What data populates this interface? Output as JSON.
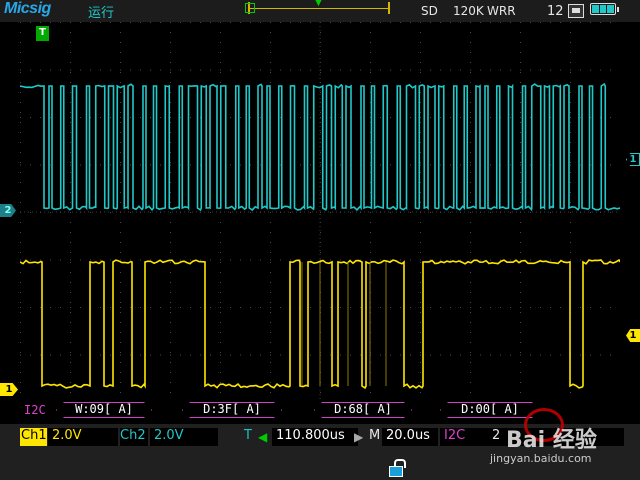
{
  "header": {
    "brand": "Micsig",
    "status": "运行",
    "acq_mode": "SD",
    "memory_depth": "120K",
    "mode": "WRR",
    "clock": "12"
  },
  "icons": {
    "usb": "usb-icon",
    "battery": "battery-icon",
    "lock": "lock-icon",
    "trigger_time": "trigger-time-marker-icon"
  },
  "markers": {
    "trigger_time": "T",
    "ch2": "2",
    "ch1": "1",
    "ch1_level": "1",
    "ch2_level": "1"
  },
  "decode": {
    "label": "I2C",
    "packets": [
      {
        "text": "W:09[ A]"
      },
      {
        "text": "D:3F[ A]"
      },
      {
        "text": "D:68[ A]"
      },
      {
        "text": "D:00[ A]"
      }
    ]
  },
  "bottom": {
    "ch1_label": "Ch1",
    "ch1_scale": "2.0V",
    "ch2_label": "Ch2",
    "ch2_scale": "2.0V",
    "trigger_label": "T",
    "trigger_position": "110.800us",
    "memory_label": "M",
    "time_scale": "20.0us",
    "bus_label": "I2C",
    "bus_extra": "2"
  },
  "watermark": {
    "brand": "Bai 经验",
    "url": "jingyan.baidu.com"
  },
  "colors": {
    "ch1": "#ffe600",
    "ch2": "#20c8c8",
    "decode": "#d040c8",
    "grid": "#4a4a4a",
    "trigger": "#00c000"
  }
}
